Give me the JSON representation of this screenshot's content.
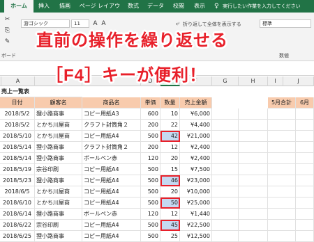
{
  "ribbon": {
    "tabs": [
      "ホーム",
      "挿入",
      "描画",
      "ページ レイアウト",
      "数式",
      "データ",
      "校閲",
      "表示"
    ],
    "active_tab": "ホーム",
    "tell_me": "実行したい作業を入力してください",
    "font_name": "游ゴシック",
    "font_size": "11",
    "wrap_text": "折り返して全体を表示する",
    "number_format": "標準",
    "group_clipboard_fragment": "ボード",
    "group_number": "数値"
  },
  "headline": {
    "line1": "直前の操作を繰り返せる",
    "line2": "［F4］キーが便利！"
  },
  "sheet": {
    "columns": [
      "A",
      "B",
      "C",
      "D",
      "E",
      "F",
      "G",
      "H",
      "I",
      "J"
    ],
    "selected_column": "E",
    "title": "売上一覧表",
    "headers": [
      "日付",
      "顧客名",
      "商品名",
      "単価",
      "数量",
      "売上金額"
    ],
    "side_headers": [
      "5月合計",
      "6月"
    ],
    "rows": [
      [
        "2018/5/2",
        "狸小路商事",
        "コピー用紙A3",
        "600",
        "10",
        "¥6,000"
      ],
      [
        "2018/5/2",
        "とかち川屋商",
        "クラフト封筒角２",
        "200",
        "22",
        "¥4,400"
      ],
      [
        "2018/5/10",
        "とかち川屋商",
        "コピー用紙A4",
        "500",
        "42",
        "¥21,000"
      ],
      [
        "2018/5/14",
        "狸小路商事",
        "クラフト封筒角２",
        "200",
        "12",
        "¥2,400"
      ],
      [
        "2018/5/14",
        "狸小路商事",
        "ボールペン赤",
        "120",
        "20",
        "¥2,400"
      ],
      [
        "2018/5/19",
        "宗谷印刷",
        "コピー用紙A4",
        "500",
        "15",
        "¥7,500"
      ],
      [
        "2018/5/23",
        "狸小路商事",
        "コピー用紙A4",
        "500",
        "46",
        "¥23,000"
      ],
      [
        "2018/6/5",
        "とかち川屋商",
        "コピー用紙A4",
        "500",
        "20",
        "¥10,000"
      ],
      [
        "2018/6/10",
        "とかち川屋商",
        "コピー用紙A4",
        "500",
        "50",
        "¥25,000"
      ],
      [
        "2018/6/14",
        "狸小路商事",
        "ボールペン赤",
        "120",
        "12",
        "¥1,440"
      ],
      [
        "2018/6/22",
        "宗谷印刷",
        "コピー用紙A4",
        "500",
        "45",
        "¥22,500"
      ],
      [
        "2018/6/25",
        "狸小路商事",
        "コピー用紙A4",
        "500",
        "25",
        "¥12,500"
      ]
    ],
    "highlighted_rows": [
      2,
      6,
      8,
      10
    ],
    "colors": {
      "header_fill": "#f8cbad",
      "highlight_fill": "#c5d9f1",
      "highlight_border": "#e8202a",
      "accent": "#217346"
    }
  }
}
